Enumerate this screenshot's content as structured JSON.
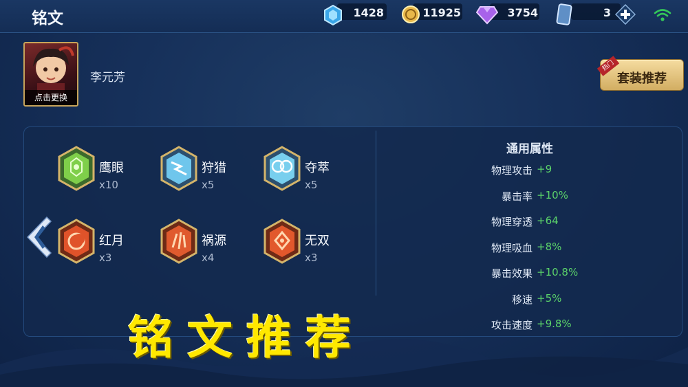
{
  "header": {
    "title": "铭文"
  },
  "resources": [
    {
      "name": "diamond-coupon",
      "value": "1428",
      "icon": "blue-crystal-icon",
      "color": "#7fd4ff"
    },
    {
      "name": "gold",
      "value": "11925",
      "icon": "gold-coin-icon",
      "color": "#e8b84a"
    },
    {
      "name": "gem",
      "value": "3754",
      "icon": "purple-gem-icon",
      "color": "#b16cf0"
    },
    {
      "name": "card",
      "value": "3",
      "icon": "blue-card-icon",
      "color": "#8db7e6"
    }
  ],
  "hero": {
    "name": "李元芳",
    "change_label": "点击更换"
  },
  "set_button": {
    "label": "套装推荐",
    "tag": "热门"
  },
  "runes": [
    {
      "name": "鹰眼",
      "count": "x10",
      "color": "green",
      "icon": "rune-green-icon"
    },
    {
      "name": "狩猎",
      "count": "x5",
      "color": "blue",
      "icon": "rune-blue-icon"
    },
    {
      "name": "夺萃",
      "count": "x5",
      "color": "blue",
      "icon": "rune-blue-icon"
    },
    {
      "name": "红月",
      "count": "x3",
      "color": "red",
      "icon": "rune-red-icon"
    },
    {
      "name": "祸源",
      "count": "x4",
      "color": "red",
      "icon": "rune-red-icon"
    },
    {
      "name": "无双",
      "count": "x3",
      "color": "red",
      "icon": "rune-red-icon"
    }
  ],
  "attributes": {
    "title": "通用属性",
    "items": [
      {
        "label": "物理攻击",
        "value": "+9"
      },
      {
        "label": "暴击率",
        "value": "+10%"
      },
      {
        "label": "物理穿透",
        "value": "+64"
      },
      {
        "label": "物理吸血",
        "value": "+8%"
      },
      {
        "label": "暴击效果",
        "value": "+10.8%"
      },
      {
        "label": "移速",
        "value": "+5%"
      },
      {
        "label": "攻击速度",
        "value": "+9.8%"
      }
    ]
  },
  "banner": {
    "text": "铭文推荐"
  },
  "colors": {
    "accent_value": "#5bd36a",
    "banner": "#ffe800",
    "gold": "#d2ad62"
  }
}
